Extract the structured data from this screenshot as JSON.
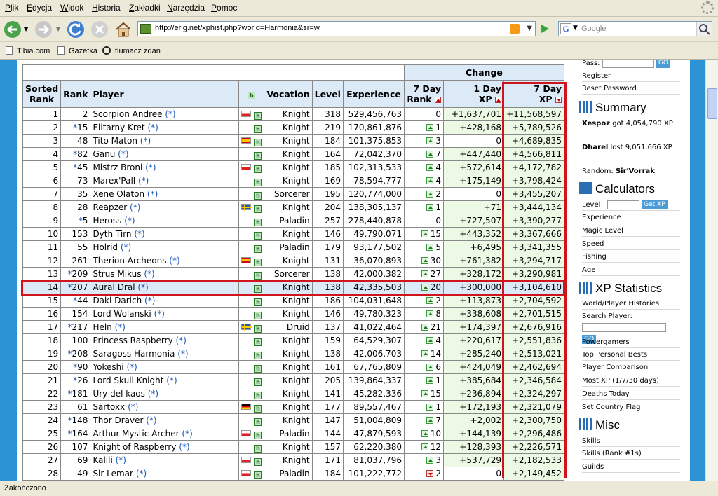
{
  "menu": [
    "Plik",
    "Edycja",
    "Widok",
    "Historia",
    "Zakładki",
    "Narzędzia",
    "Pomoc"
  ],
  "url": "http://erig.net/xphist.php?world=Harmonia&sr=w",
  "search_placeholder": "Google",
  "bookmarks": [
    "Tibia.com",
    "Gazetka",
    "tlumacz zdan"
  ],
  "status": "Zakończono",
  "table": {
    "change_header": "Change",
    "headers": {
      "sorted_rank": [
        "Sorted",
        "Rank"
      ],
      "rank": "Rank",
      "player": "Player",
      "vocation": "Vocation",
      "level": "Level",
      "experience": "Experience",
      "rank7": [
        "7 Day",
        "Rank"
      ],
      "xp1": [
        "1 Day",
        "XP"
      ],
      "xp7": [
        "7 Day",
        "XP"
      ],
      "hist_icon": "h"
    },
    "rows": [
      {
        "n": "1",
        "star": "",
        "rank": "2",
        "name": "Scorpion Andree",
        "flag": "pl",
        "voc": "Knight",
        "lvl": "318",
        "exp": "529,456,763",
        "dir": "",
        "r7": "0",
        "xp1": "+1,637,701",
        "xp7": "+11,568,597"
      },
      {
        "n": "2",
        "star": "*",
        "rank": "15",
        "name": "Elitarny Kret",
        "flag": "",
        "voc": "Knight",
        "lvl": "219",
        "exp": "170,861,876",
        "dir": "up",
        "r7": "1",
        "xp1": "+428,168",
        "xp7": "+5,789,526"
      },
      {
        "n": "3",
        "star": "",
        "rank": "48",
        "name": "Tito Maton",
        "flag": "es",
        "voc": "Knight",
        "lvl": "184",
        "exp": "101,375,853",
        "dir": "up",
        "r7": "3",
        "xp1": "0",
        "xp7": "+4,689,835"
      },
      {
        "n": "4",
        "star": "*",
        "rank": "82",
        "name": "Ganu",
        "flag": "",
        "voc": "Knight",
        "lvl": "164",
        "exp": "72,042,370",
        "dir": "up",
        "r7": "7",
        "xp1": "+447,440",
        "xp7": "+4,566,811"
      },
      {
        "n": "5",
        "star": "*",
        "rank": "45",
        "name": "Mistrz Broni",
        "flag": "pl",
        "voc": "Knight",
        "lvl": "185",
        "exp": "102,313,533",
        "dir": "up",
        "r7": "4",
        "xp1": "+572,614",
        "xp7": "+4,172,782"
      },
      {
        "n": "6",
        "star": "",
        "rank": "73",
        "name": "Marex'Pall",
        "flag": "",
        "voc": "Knight",
        "lvl": "169",
        "exp": "78,594,777",
        "dir": "up",
        "r7": "4",
        "xp1": "+175,149",
        "xp7": "+3,798,424"
      },
      {
        "n": "7",
        "star": "",
        "rank": "35",
        "name": "Xene Olaton",
        "flag": "",
        "voc": "Sorcerer",
        "lvl": "195",
        "exp": "120,774,000",
        "dir": "up",
        "r7": "2",
        "xp1": "0",
        "xp7": "+3,455,207"
      },
      {
        "n": "8",
        "star": "",
        "rank": "28",
        "name": "Reapzer",
        "flag": "se",
        "voc": "Knight",
        "lvl": "204",
        "exp": "138,305,137",
        "dir": "up",
        "r7": "1",
        "xp1": "+71",
        "xp7": "+3,444,134"
      },
      {
        "n": "9",
        "star": "*",
        "rank": "5",
        "name": "Heross",
        "flag": "",
        "voc": "Paladin",
        "lvl": "257",
        "exp": "278,440,878",
        "dir": "",
        "r7": "0",
        "xp1": "+727,507",
        "xp7": "+3,390,277"
      },
      {
        "n": "10",
        "star": "",
        "rank": "153",
        "name": "Dyth Tirn",
        "flag": "",
        "voc": "Knight",
        "lvl": "146",
        "exp": "49,790,071",
        "dir": "up",
        "r7": "15",
        "xp1": "+443,352",
        "xp7": "+3,367,666"
      },
      {
        "n": "11",
        "star": "",
        "rank": "55",
        "name": "Holrid",
        "flag": "",
        "voc": "Paladin",
        "lvl": "179",
        "exp": "93,177,502",
        "dir": "up",
        "r7": "5",
        "xp1": "+6,495",
        "xp7": "+3,341,355"
      },
      {
        "n": "12",
        "star": "",
        "rank": "261",
        "name": "Therion Archeons",
        "flag": "es",
        "voc": "Knight",
        "lvl": "131",
        "exp": "36,070,893",
        "dir": "up",
        "r7": "30",
        "xp1": "+761,382",
        "xp7": "+3,294,717"
      },
      {
        "n": "13",
        "star": "*",
        "rank": "209",
        "name": "Strus Mikus",
        "flag": "",
        "voc": "Sorcerer",
        "lvl": "138",
        "exp": "42,000,382",
        "dir": "up",
        "r7": "27",
        "xp1": "+328,172",
        "xp7": "+3,290,981"
      },
      {
        "n": "14",
        "star": "*",
        "rank": "207",
        "name": "Aural Dral",
        "flag": "",
        "voc": "Knight",
        "lvl": "138",
        "exp": "42,335,503",
        "dir": "up",
        "r7": "20",
        "xp1": "+300,000",
        "xp7": "+3,104,610"
      },
      {
        "n": "15",
        "star": "*",
        "rank": "44",
        "name": "Daki Darich",
        "flag": "",
        "voc": "Knight",
        "lvl": "186",
        "exp": "104,031,648",
        "dir": "up",
        "r7": "2",
        "xp1": "+113,873",
        "xp7": "+2,704,592"
      },
      {
        "n": "16",
        "star": "",
        "rank": "154",
        "name": "Lord Wolanski",
        "flag": "",
        "voc": "Knight",
        "lvl": "146",
        "exp": "49,780,323",
        "dir": "up",
        "r7": "8",
        "xp1": "+338,608",
        "xp7": "+2,701,515"
      },
      {
        "n": "17",
        "star": "*",
        "rank": "217",
        "name": "Heln",
        "flag": "se",
        "voc": "Druid",
        "lvl": "137",
        "exp": "41,022,464",
        "dir": "up",
        "r7": "21",
        "xp1": "+174,397",
        "xp7": "+2,676,916"
      },
      {
        "n": "18",
        "star": "",
        "rank": "100",
        "name": "Princess Raspberry",
        "flag": "",
        "voc": "Knight",
        "lvl": "159",
        "exp": "64,529,307",
        "dir": "up",
        "r7": "4",
        "xp1": "+220,617",
        "xp7": "+2,551,836"
      },
      {
        "n": "19",
        "star": "*",
        "rank": "208",
        "name": "Saragoss Harmonia",
        "flag": "",
        "voc": "Knight",
        "lvl": "138",
        "exp": "42,006,703",
        "dir": "up",
        "r7": "14",
        "xp1": "+285,240",
        "xp7": "+2,513,021"
      },
      {
        "n": "20",
        "star": "*",
        "rank": "90",
        "name": "Yokeshi",
        "flag": "",
        "voc": "Knight",
        "lvl": "161",
        "exp": "67,765,809",
        "dir": "up",
        "r7": "6",
        "xp1": "+424,049",
        "xp7": "+2,462,694"
      },
      {
        "n": "21",
        "star": "*",
        "rank": "26",
        "name": "Lord Skull Knight",
        "flag": "",
        "voc": "Knight",
        "lvl": "205",
        "exp": "139,864,337",
        "dir": "up",
        "r7": "1",
        "xp1": "+385,684",
        "xp7": "+2,346,584"
      },
      {
        "n": "22",
        "star": "*",
        "rank": "181",
        "name": "Ury del kaos",
        "flag": "",
        "voc": "Knight",
        "lvl": "141",
        "exp": "45,282,336",
        "dir": "up",
        "r7": "15",
        "xp1": "+236,894",
        "xp7": "+2,324,297"
      },
      {
        "n": "23",
        "star": "",
        "rank": "61",
        "name": "Sartoxx",
        "flag": "de",
        "voc": "Knight",
        "lvl": "177",
        "exp": "89,557,467",
        "dir": "up",
        "r7": "1",
        "xp1": "+172,193",
        "xp7": "+2,321,079"
      },
      {
        "n": "24",
        "star": "*",
        "rank": "148",
        "name": "Thor Draver",
        "flag": "",
        "voc": "Knight",
        "lvl": "147",
        "exp": "51,004,809",
        "dir": "up",
        "r7": "7",
        "xp1": "+2,002",
        "xp7": "+2,300,750"
      },
      {
        "n": "25",
        "star": "*",
        "rank": "164",
        "name": "Arthur-Mystic Archer",
        "flag": "pl",
        "voc": "Paladin",
        "lvl": "144",
        "exp": "47,879,593",
        "dir": "up",
        "r7": "10",
        "xp1": "+144,139",
        "xp7": "+2,296,486"
      },
      {
        "n": "26",
        "star": "",
        "rank": "107",
        "name": "Knight of Raspberry",
        "flag": "",
        "voc": "Knight",
        "lvl": "157",
        "exp": "62,220,380",
        "dir": "up",
        "r7": "12",
        "xp1": "+128,393",
        "xp7": "+2,226,571"
      },
      {
        "n": "27",
        "star": "",
        "rank": "69",
        "name": "Kalili",
        "flag": "pl",
        "voc": "Knight",
        "lvl": "171",
        "exp": "81,037,796",
        "dir": "up",
        "r7": "3",
        "xp1": "+537,729",
        "xp7": "+2,182,533"
      },
      {
        "n": "28",
        "star": "",
        "rank": "49",
        "name": "Sir Lemar",
        "flag": "pl",
        "voc": "Paladin",
        "lvl": "184",
        "exp": "101,222,772",
        "dir": "dn",
        "r7": "2",
        "xp1": "0",
        "xp7": "+2,149,452"
      }
    ],
    "highlight_row": "14",
    "link_suffix": "(*)"
  },
  "sidebar": {
    "pass_label": "Pass:",
    "register": "Register",
    "reset_password": "Reset Password",
    "summary_title": "Summary",
    "summary_1_name": "Xespoz",
    "summary_1_text": " got 4,054,790 XP",
    "summary_2_name": "Dharel",
    "summary_2_text": " lost 9,051,666 XP",
    "random_label": "Random: ",
    "random_value": "Sir'Vorrak",
    "calculators_title": "Calculators",
    "level_label": "Level",
    "get_xp": "Get XP",
    "calc_items": [
      "Experience",
      "Magic Level",
      "Speed",
      "Fishing",
      "Age"
    ],
    "xpstats_title": "XP Statistics",
    "xpstats_first": "World/Player Histories",
    "search_player": "Search Player:",
    "go": "GO",
    "xpstats_items": [
      "Powergamers",
      "Top Personal Bests",
      "Player Comparison",
      "Most XP (1/7/30 days)",
      "Deaths Today",
      "Set Country Flag"
    ],
    "misc_title": "Misc",
    "misc_items": [
      "Skills",
      "Skills (Rank #1s)",
      "Guilds"
    ]
  }
}
